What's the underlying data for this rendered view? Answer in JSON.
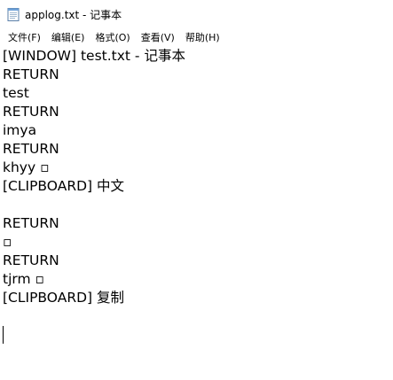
{
  "window": {
    "title": "applog.txt - 记事本",
    "icon": "notepad-icon"
  },
  "menu": {
    "items": [
      {
        "label": "文件(F)"
      },
      {
        "label": "编辑(E)"
      },
      {
        "label": "格式(O)"
      },
      {
        "label": "查看(V)"
      },
      {
        "label": "帮助(H)"
      }
    ]
  },
  "editor": {
    "lines": [
      "[WINDOW] test.txt - 记事本",
      "RETURN",
      "test",
      "RETURN",
      "imya",
      "RETURN",
      "khyy ▫",
      "[CLIPBOARD] 中文",
      "",
      "RETURN",
      "▫",
      "RETURN",
      "tjrm ▫",
      "[CLIPBOARD] 复制",
      ""
    ]
  }
}
